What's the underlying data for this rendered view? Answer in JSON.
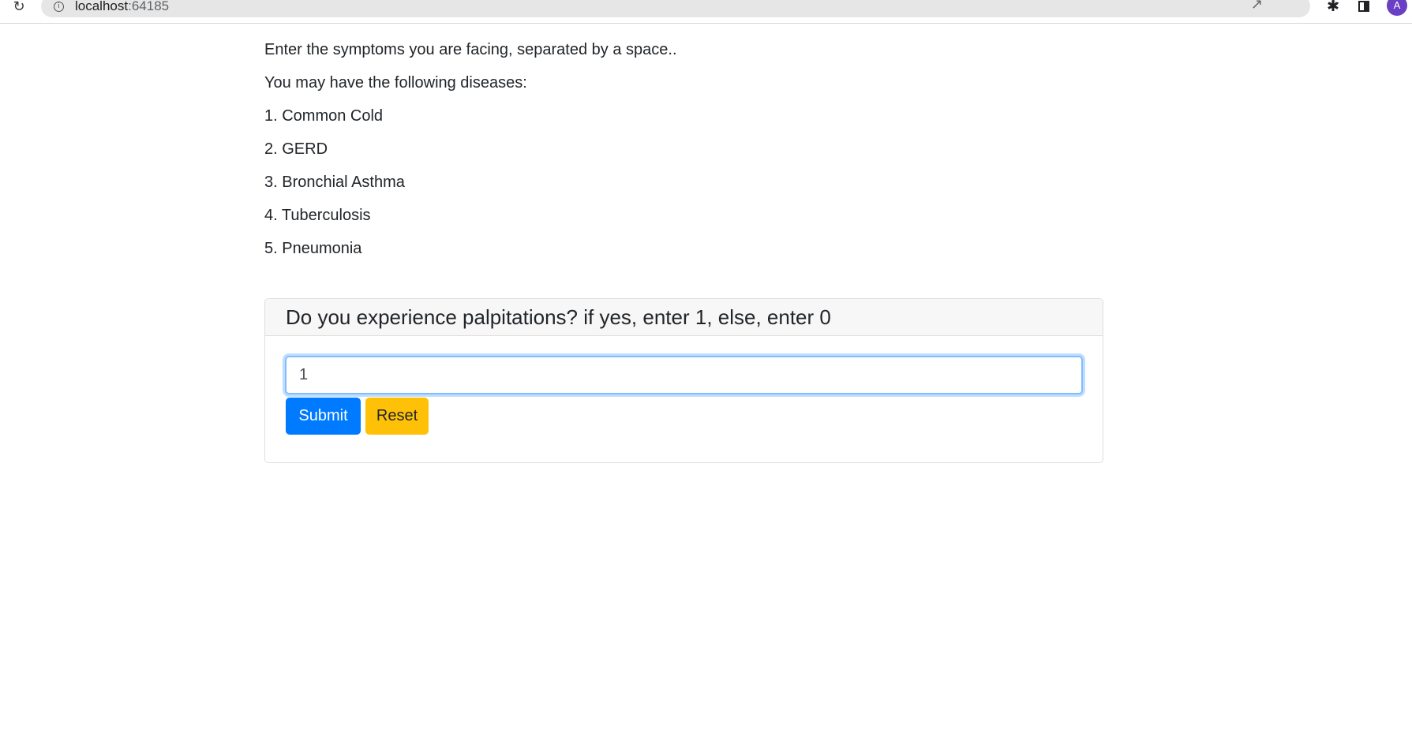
{
  "browser": {
    "url_host": "localhost",
    "url_port": ":64185",
    "avatar_letter": "A",
    "icons": [
      "reload-icon",
      "info-icon",
      "share-icon",
      "star-icon",
      "extensions-icon",
      "side-panel-icon"
    ]
  },
  "page": {
    "instruction": "Enter the symptoms you are facing, separated by a space..",
    "results_heading": "You may have the following diseases:",
    "diseases": [
      "1. Common Cold",
      "2. GERD",
      "3. Bronchial Asthma",
      "4. Tuberculosis",
      "5. Pneumonia"
    ]
  },
  "question_card": {
    "question": "Do you experience palpitations? if yes, enter 1, else, enter 0",
    "answer_value": "1",
    "submit_label": "Submit",
    "reset_label": "Reset"
  },
  "colors": {
    "submit_bg": "#007bff",
    "reset_bg": "#ffc107",
    "avatar_bg": "#6a3fc3"
  }
}
